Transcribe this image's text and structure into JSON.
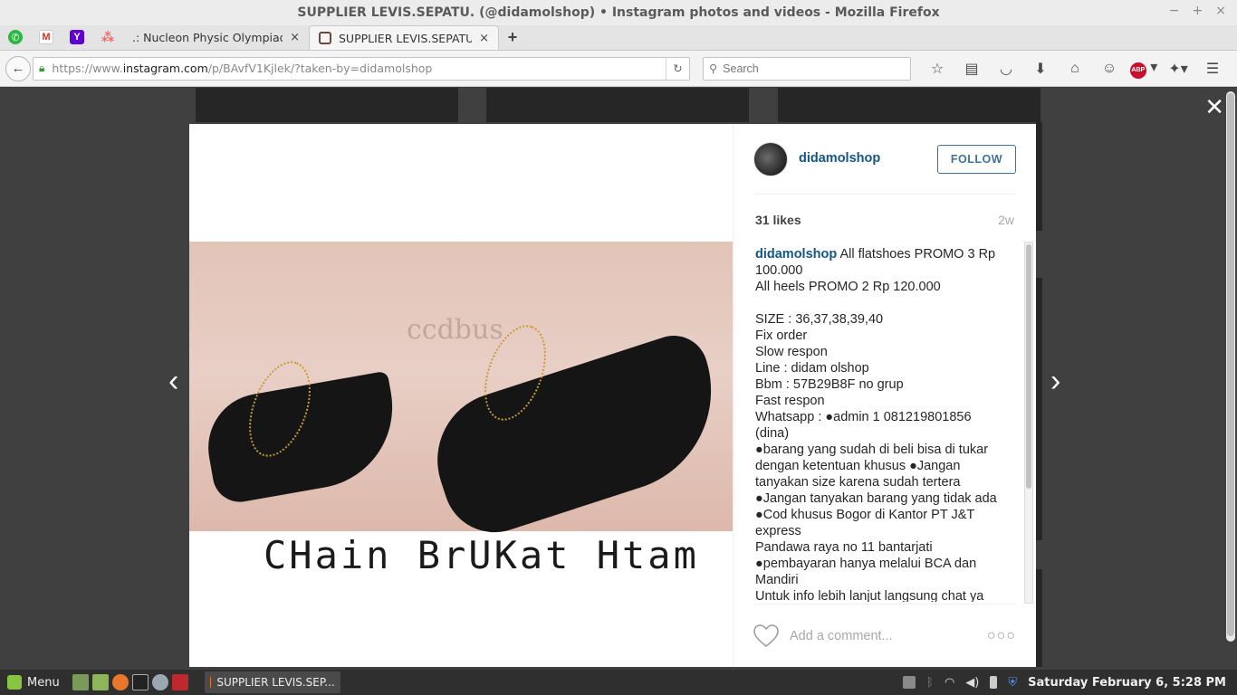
{
  "window": {
    "title": "SUPPLIER LEVIS.SEPATU. (@didamolshop) • Instagram photos and videos - Mozilla Firefox",
    "minimize": "−",
    "maximize": "+",
    "close": "×"
  },
  "tabs": [
    {
      "label": ".: Nucleon Physic Olympiad (...",
      "close": "×"
    },
    {
      "label": "SUPPLIER LEVIS.SEPATU. ...",
      "close": "×"
    }
  ],
  "new_tab": "+",
  "navbar": {
    "url_prefix": "https://www.",
    "url_host": "instagram.com",
    "url_path": "/p/BAvfV1Kjlek/?taken-by=didamolshop",
    "search_placeholder": "Search"
  },
  "post": {
    "username": "didamolshop",
    "follow_label": "FOLLOW",
    "likes": "31 likes",
    "age": "2w",
    "caption_user": "didamolshop",
    "caption_text": " All flatshoes PROMO 3 Rp 100.000\nAll heels PROMO 2 Rp 120.000\n\nSIZE : 36,37,38,39,40\nFix order\nSlow respon\nLine : didam olshop\nBbm : 57B29B8F no grup\nFast respon\nWhatsapp : ●admin 1 081219801856 (dina)\n●barang yang sudah di beli bisa di tukar dengan ketentuan khusus ●Jangan tanyakan size karena sudah tertera\n●Jangan tanyakan barang yang tidak ada\n●Cod khusus Bogor di Kantor PT J&T express\nPandawa raya no 11 bantarjati\n●pembayaran hanya melalui BCA dan Mandiri\nUntuk info lebih lanjut langsung chat ya",
    "comment_placeholder": "Add a comment...",
    "more": "○○○",
    "photo_text": "CHain BrUKat Htam",
    "photo_watermark": "ccdbus"
  },
  "lightbox": {
    "close": "✕",
    "prev": "‹",
    "next": "›"
  },
  "taskbar": {
    "menu_label": "Menu",
    "task_label": "SUPPLIER LEVIS.SEP...",
    "clock": "Saturday February  6,  5:28 PM"
  }
}
